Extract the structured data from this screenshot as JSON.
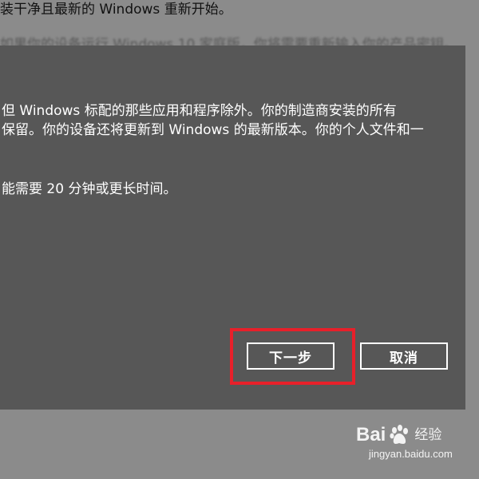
{
  "background": {
    "line1": "装干净且最新的 Windows 重新开始。",
    "line2": "如果你的设备运行 Windows 10 家庭版，你将需要重新输入你的产品密钥。"
  },
  "dialog": {
    "paragraph1_line1": "但 Windows 标配的那些应用和程序除外。你的制造商安装的所有",
    "paragraph1_line2": "保留。你的设备还将更新到 Windows 的最新版本。你的个人文件和一",
    "paragraph2": "能需要 20 分钟或更长时间。",
    "next_button_label": "下一步",
    "cancel_button_label": "取消"
  },
  "watermark": {
    "brand_left": "Bai",
    "brand_right": "经验",
    "url": "jingyan.baidu.com"
  },
  "colors": {
    "page_background": "#8b8b8b",
    "dialog_background": "#575757",
    "highlight": "#e8202a",
    "text_on_dialog": "#ffffff"
  }
}
